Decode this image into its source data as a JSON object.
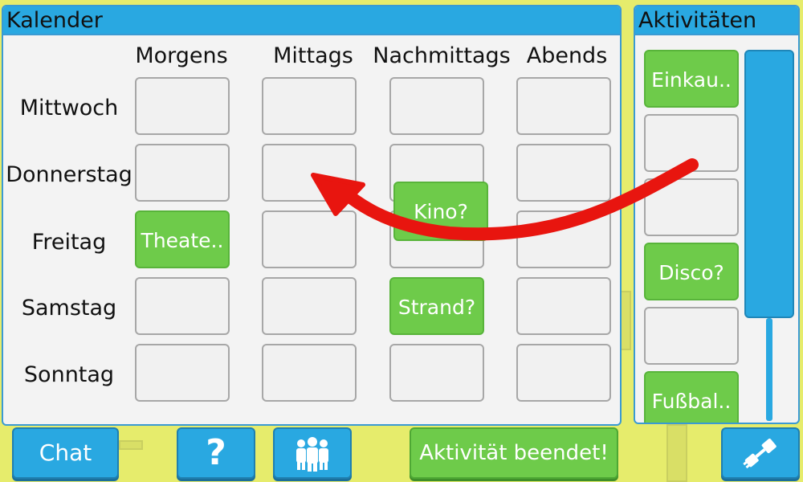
{
  "calendar": {
    "title": "Kalender",
    "columns": [
      "Morgens",
      "Mittags",
      "Nachmittags",
      "Abends"
    ],
    "rows": [
      "Mittwoch",
      "Donnerstag",
      "Freitag",
      "Samstag",
      "Sonntag"
    ],
    "entries": {
      "freitag_morgens": "Theate..",
      "donnerstag_nachmittags": "Kino?",
      "samstag_nachmittags": "Strand?"
    }
  },
  "activities": {
    "title": "Aktivitäten",
    "items": [
      "Einkau..",
      "",
      "",
      "Disco?",
      "",
      "Fußbal.."
    ]
  },
  "toolbar": {
    "chat_label": "Chat",
    "help_label": "?",
    "activity_done_label": "Aktivität beendet!"
  },
  "colors": {
    "background": "#e6ec6c",
    "header_blue": "#29a8e1",
    "activity_green": "#6ecb4a",
    "drag_arrow": "#e8150f"
  },
  "icons": {
    "people": "group-people-icon",
    "settings": "plug-icon"
  }
}
